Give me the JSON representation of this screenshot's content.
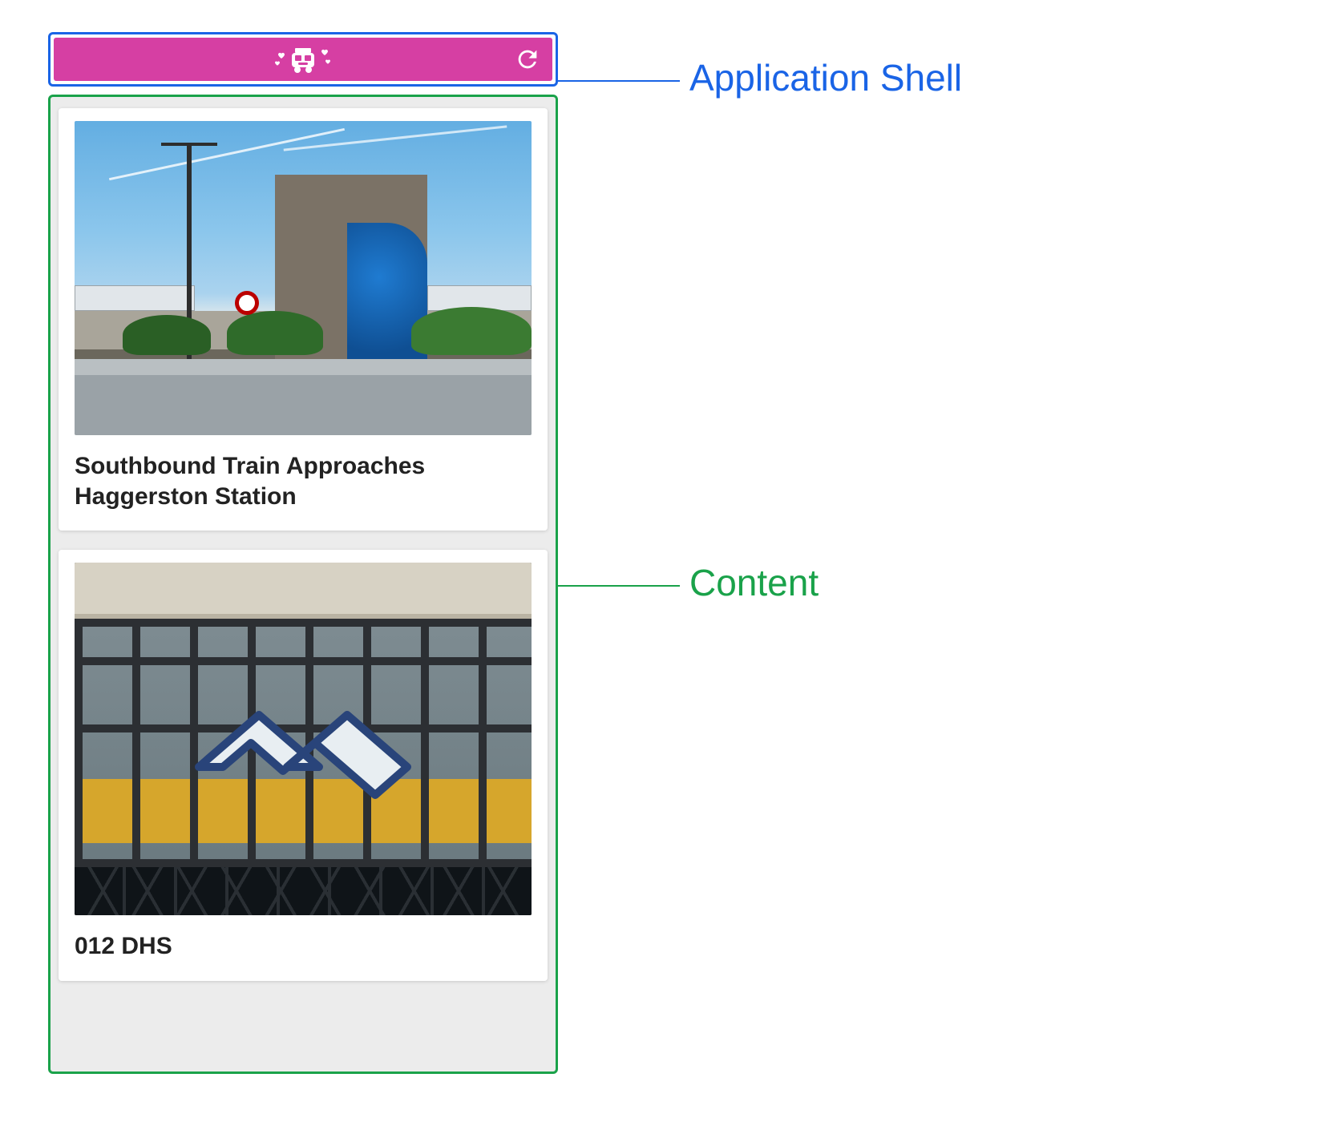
{
  "colors": {
    "shell_border": "#1a64e6",
    "content_border": "#1aa24a",
    "header_bg": "#d63fa3",
    "header_icon": "#ffffff"
  },
  "annotations": {
    "shell_label": "Application Shell",
    "content_label": "Content"
  },
  "header": {
    "app_icon_name": "train-hearts-icon",
    "refresh_icon_name": "refresh-icon"
  },
  "cards": [
    {
      "title": "Southbound Train Approaches Haggerston Station"
    },
    {
      "title": "012 DHS"
    }
  ]
}
